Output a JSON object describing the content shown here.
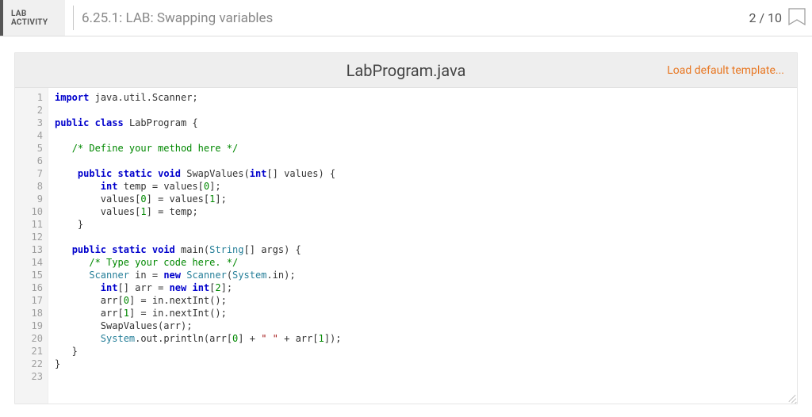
{
  "header": {
    "lab_label_line1": "LAB",
    "lab_label_line2": "ACTIVITY",
    "title": "6.25.1: LAB: Swapping variables",
    "score": "2 / 10"
  },
  "editor": {
    "filename": "LabProgram.java",
    "load_template_label": "Load default template...",
    "lines": [
      {
        "n": 1,
        "tokens": [
          [
            "kw",
            "import"
          ],
          [
            "sp",
            " "
          ],
          [
            "pkg",
            "java.util.Scanner"
          ],
          [
            "p",
            ";"
          ]
        ]
      },
      {
        "n": 2,
        "tokens": []
      },
      {
        "n": 3,
        "tokens": [
          [
            "kw",
            "public"
          ],
          [
            "sp",
            " "
          ],
          [
            "kw",
            "class"
          ],
          [
            "sp",
            " "
          ],
          [
            "cls",
            "LabProgram"
          ],
          [
            "sp",
            " "
          ],
          [
            "p",
            "{"
          ]
        ]
      },
      {
        "n": 4,
        "tokens": []
      },
      {
        "n": 5,
        "tokens": [
          [
            "sp",
            "   "
          ],
          [
            "com",
            "/* Define your method here */"
          ]
        ]
      },
      {
        "n": 6,
        "tokens": []
      },
      {
        "n": 7,
        "tokens": [
          [
            "sp",
            "    "
          ],
          [
            "kw",
            "public"
          ],
          [
            "sp",
            " "
          ],
          [
            "kw",
            "static"
          ],
          [
            "sp",
            " "
          ],
          [
            "kw",
            "void"
          ],
          [
            "sp",
            " "
          ],
          [
            "fn",
            "SwapValues"
          ],
          [
            "p",
            "("
          ],
          [
            "kw",
            "int"
          ],
          [
            "p",
            "[] "
          ],
          [
            "id",
            "values"
          ],
          [
            "p",
            ") {"
          ]
        ]
      },
      {
        "n": 8,
        "tokens": [
          [
            "sp",
            "        "
          ],
          [
            "kw",
            "int"
          ],
          [
            "sp",
            " "
          ],
          [
            "id",
            "temp"
          ],
          [
            "sp",
            " = "
          ],
          [
            "id",
            "values"
          ],
          [
            "p",
            "["
          ],
          [
            "num",
            "0"
          ],
          [
            "p",
            "];"
          ]
        ]
      },
      {
        "n": 9,
        "tokens": [
          [
            "sp",
            "        "
          ],
          [
            "id",
            "values"
          ],
          [
            "p",
            "["
          ],
          [
            "num",
            "0"
          ],
          [
            "p",
            "] = "
          ],
          [
            "id",
            "values"
          ],
          [
            "p",
            "["
          ],
          [
            "num",
            "1"
          ],
          [
            "p",
            "];"
          ]
        ]
      },
      {
        "n": 10,
        "tokens": [
          [
            "sp",
            "        "
          ],
          [
            "id",
            "values"
          ],
          [
            "p",
            "["
          ],
          [
            "num",
            "1"
          ],
          [
            "p",
            "] = "
          ],
          [
            "id",
            "temp"
          ],
          [
            "p",
            ";"
          ]
        ]
      },
      {
        "n": 11,
        "tokens": [
          [
            "sp",
            "    "
          ],
          [
            "p",
            "}"
          ]
        ]
      },
      {
        "n": 12,
        "tokens": []
      },
      {
        "n": 13,
        "tokens": [
          [
            "sp",
            "   "
          ],
          [
            "kw",
            "public"
          ],
          [
            "sp",
            " "
          ],
          [
            "kw",
            "static"
          ],
          [
            "sp",
            " "
          ],
          [
            "kw",
            "void"
          ],
          [
            "sp",
            " "
          ],
          [
            "fn",
            "main"
          ],
          [
            "p",
            "("
          ],
          [
            "type",
            "String"
          ],
          [
            "p",
            "[] "
          ],
          [
            "id",
            "args"
          ],
          [
            "p",
            ") {"
          ]
        ]
      },
      {
        "n": 14,
        "tokens": [
          [
            "sp",
            "      "
          ],
          [
            "com",
            "/* Type your code here. */"
          ]
        ]
      },
      {
        "n": 15,
        "tokens": [
          [
            "sp",
            "      "
          ],
          [
            "type",
            "Scanner"
          ],
          [
            "sp",
            " "
          ],
          [
            "id",
            "in"
          ],
          [
            "sp",
            " = "
          ],
          [
            "kw",
            "new"
          ],
          [
            "sp",
            " "
          ],
          [
            "type",
            "Scanner"
          ],
          [
            "p",
            "("
          ],
          [
            "sys",
            "System"
          ],
          [
            "p",
            "."
          ],
          [
            "id",
            "in"
          ],
          [
            "p",
            ");"
          ]
        ]
      },
      {
        "n": 16,
        "tokens": [
          [
            "sp",
            "        "
          ],
          [
            "kw",
            "int"
          ],
          [
            "p",
            "[] "
          ],
          [
            "id",
            "arr"
          ],
          [
            "sp",
            " = "
          ],
          [
            "kw",
            "new"
          ],
          [
            "sp",
            " "
          ],
          [
            "kw",
            "int"
          ],
          [
            "p",
            "["
          ],
          [
            "num",
            "2"
          ],
          [
            "p",
            "];"
          ]
        ]
      },
      {
        "n": 17,
        "tokens": [
          [
            "sp",
            "        "
          ],
          [
            "id",
            "arr"
          ],
          [
            "p",
            "["
          ],
          [
            "num",
            "0"
          ],
          [
            "p",
            "] = "
          ],
          [
            "id",
            "in"
          ],
          [
            "p",
            "."
          ],
          [
            "fn",
            "nextInt"
          ],
          [
            "p",
            "();"
          ]
        ]
      },
      {
        "n": 18,
        "tokens": [
          [
            "sp",
            "        "
          ],
          [
            "id",
            "arr"
          ],
          [
            "p",
            "["
          ],
          [
            "num",
            "1"
          ],
          [
            "p",
            "] = "
          ],
          [
            "id",
            "in"
          ],
          [
            "p",
            "."
          ],
          [
            "fn",
            "nextInt"
          ],
          [
            "p",
            "();"
          ]
        ]
      },
      {
        "n": 19,
        "tokens": [
          [
            "sp",
            "        "
          ],
          [
            "fn",
            "SwapValues"
          ],
          [
            "p",
            "("
          ],
          [
            "id",
            "arr"
          ],
          [
            "p",
            ");"
          ]
        ]
      },
      {
        "n": 20,
        "tokens": [
          [
            "sp",
            "        "
          ],
          [
            "sys",
            "System"
          ],
          [
            "p",
            "."
          ],
          [
            "id",
            "out"
          ],
          [
            "p",
            "."
          ],
          [
            "fn",
            "println"
          ],
          [
            "p",
            "("
          ],
          [
            "id",
            "arr"
          ],
          [
            "p",
            "["
          ],
          [
            "num",
            "0"
          ],
          [
            "p",
            "] + "
          ],
          [
            "str",
            "\" \""
          ],
          [
            "sp",
            " + "
          ],
          [
            "id",
            "arr"
          ],
          [
            "p",
            "["
          ],
          [
            "num",
            "1"
          ],
          [
            "p",
            "]);"
          ]
        ]
      },
      {
        "n": 21,
        "tokens": [
          [
            "sp",
            "   "
          ],
          [
            "p",
            "}"
          ]
        ]
      },
      {
        "n": 22,
        "tokens": [
          [
            "p",
            "}"
          ]
        ]
      },
      {
        "n": 23,
        "tokens": []
      }
    ]
  }
}
